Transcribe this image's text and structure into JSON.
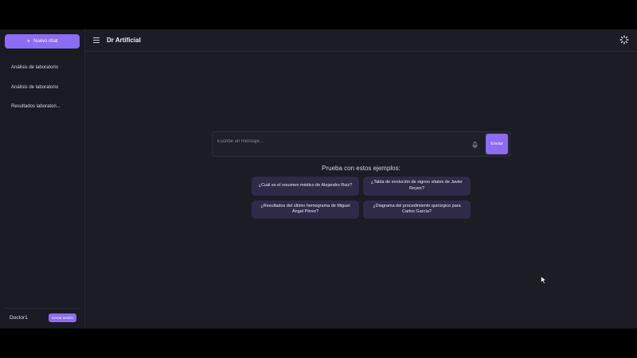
{
  "sidebar": {
    "new_chat_label": "Nuevo chat",
    "history": [
      {
        "label": "Análisis de laboratorio"
      },
      {
        "label": "Análisis de laboratorio"
      },
      {
        "label": "Resultados laboratori..."
      }
    ],
    "user_name": "Doctor1",
    "logout_label": "Cerrar sesión"
  },
  "header": {
    "title": "Dr Artificial",
    "icons": {
      "menu": "menu-icon",
      "loading": "spinner-icon"
    }
  },
  "composer": {
    "placeholder": "Escribe un mensaje...",
    "value": "",
    "send_label": "Enviar",
    "mic_icon": "microphone-icon"
  },
  "examples": {
    "title": "Prueba con estos ejemplos:",
    "items": [
      {
        "label": "¿Cuál es el resumen médico de Alejandro Ruiz?"
      },
      {
        "label": "¿Tabla de evolución de signos vitales de Javier Reyes?"
      },
      {
        "label": "¿Resultados del último hemograma de Miguel Ángel Pérez?"
      },
      {
        "label": "¿Diagrama del procedimiento quirúrgico para Carlos García?"
      }
    ]
  },
  "colors": {
    "accent": "#8b6cf2",
    "background": "#1c1c25",
    "sidebar": "#1a1a22",
    "example_chip": "#2f2a48"
  }
}
